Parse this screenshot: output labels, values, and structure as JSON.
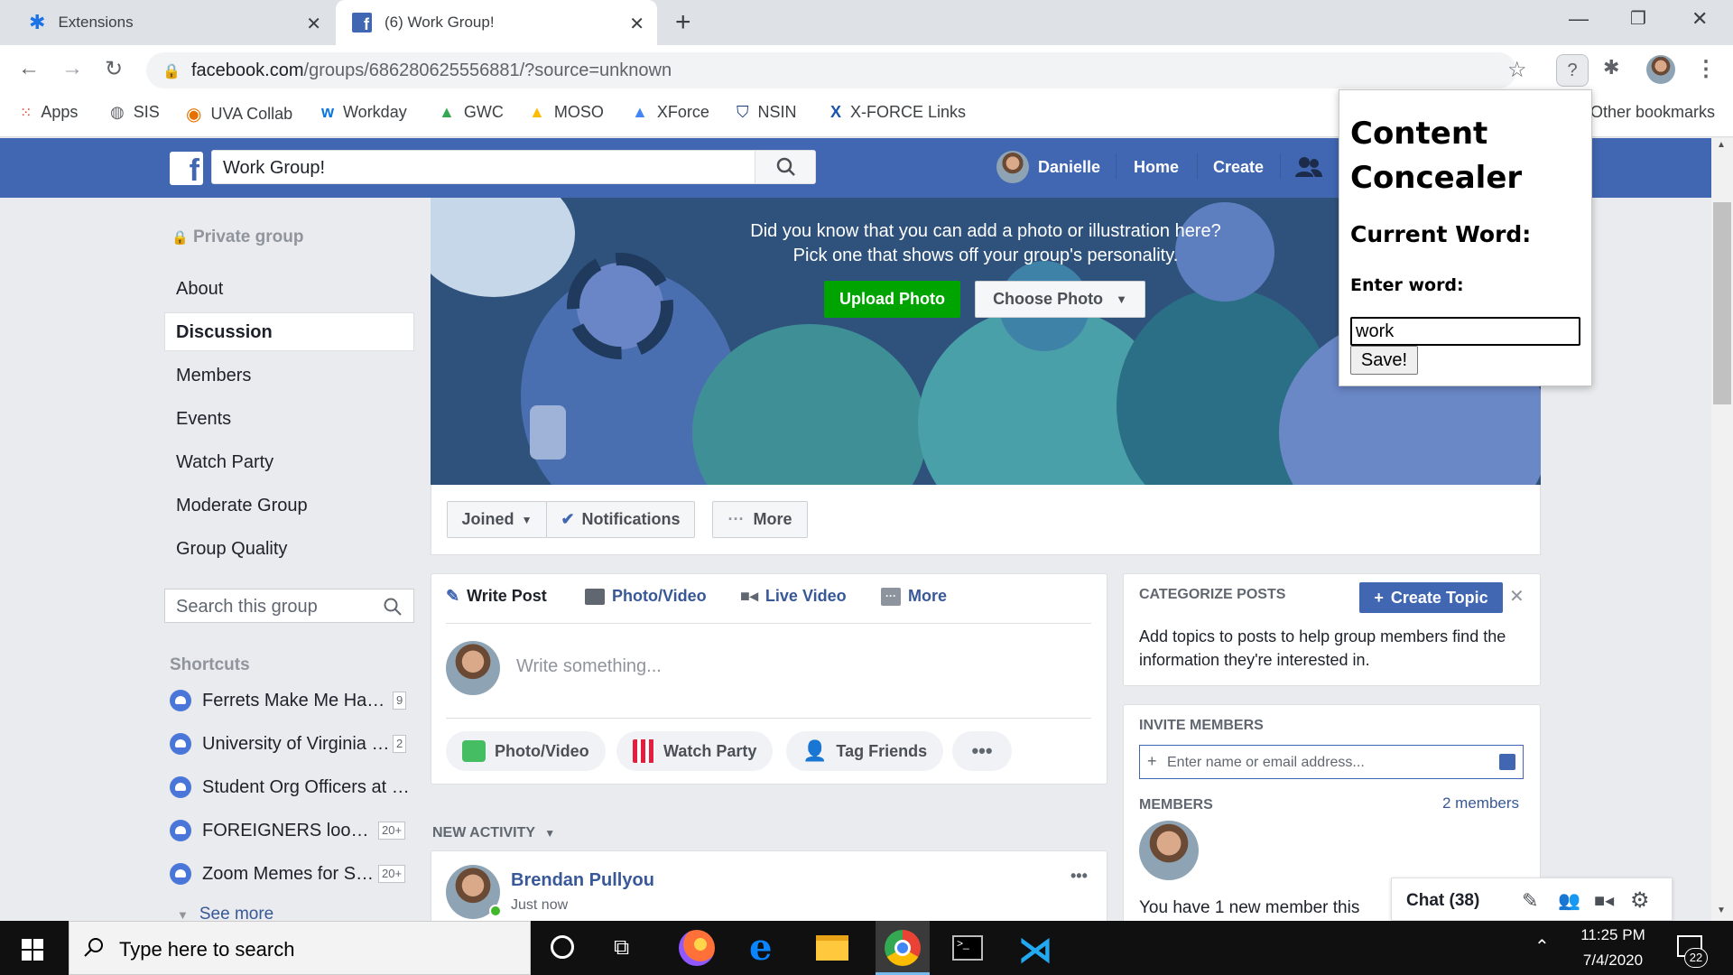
{
  "browser": {
    "tabs": [
      {
        "title": "Extensions"
      },
      {
        "title": "(6) Work Group!"
      }
    ],
    "url_host": "facebook.com",
    "url_path": "/groups/686280625556881/?source=unknown",
    "bookmarks": [
      "Apps",
      "SIS",
      "UVA Collab",
      "Workday",
      "GWC",
      "MOSO",
      "XForce",
      "NSIN",
      "X-FORCE Links"
    ],
    "other_bookmarks": "Other bookmarks"
  },
  "fb": {
    "search_value": "Work Group!",
    "user_name": "Danielle",
    "nav_home": "Home",
    "nav_create": "Create"
  },
  "sidebar": {
    "private_label": "Private group",
    "items": [
      "About",
      "Discussion",
      "Members",
      "Events",
      "Watch Party",
      "Moderate Group",
      "Group Quality"
    ],
    "search_placeholder": "Search this group",
    "shortcuts_label": "Shortcuts",
    "shortcuts": [
      {
        "name": "Ferrets Make Me Ha…",
        "count": "9"
      },
      {
        "name": "University of Virginia …",
        "count": "2"
      },
      {
        "name": "Student Org Officers at …",
        "count": ""
      },
      {
        "name": "FOREIGNERS loo…",
        "count": "20+"
      },
      {
        "name": "Zoom Memes for S…",
        "count": "20+"
      }
    ],
    "see_more": "See more"
  },
  "cover": {
    "line1": "Did you know that you can add a photo or illustration here?",
    "line2": "Pick one that shows off your group's personality.",
    "upload": "Upload Photo",
    "choose": "Choose Photo"
  },
  "group_actions": {
    "joined": "Joined",
    "notifications": "Notifications",
    "more": "More"
  },
  "composer": {
    "tabs": [
      "Write Post",
      "Photo/Video",
      "Live Video",
      "More"
    ],
    "placeholder": "Write something...",
    "actions": [
      "Photo/Video",
      "Watch Party",
      "Tag Friends"
    ]
  },
  "feed": {
    "section_label": "NEW ACTIVITY",
    "post_author": "Brendan Pullyou",
    "post_time": "Just now"
  },
  "right": {
    "categorize_title": "CATEGORIZE POSTS",
    "create_topic": "Create Topic",
    "categorize_text": "Add topics to posts to help group members find the information they're interested in.",
    "invite_title": "INVITE MEMBERS",
    "invite_placeholder": "Enter name or email address...",
    "members_title": "MEMBERS",
    "members_count": "2 members",
    "new_member_text": "You have 1 new member this"
  },
  "chat": {
    "label": "Chat (38)"
  },
  "popup": {
    "title": "Content Concealer",
    "current_word_label": "Current Word:",
    "enter_label": "Enter word:",
    "input_value": "work",
    "save": "Save!"
  },
  "taskbar": {
    "search_placeholder": "Type here to search",
    "time": "11:25 PM",
    "date": "7/4/2020",
    "notifications": "22"
  }
}
